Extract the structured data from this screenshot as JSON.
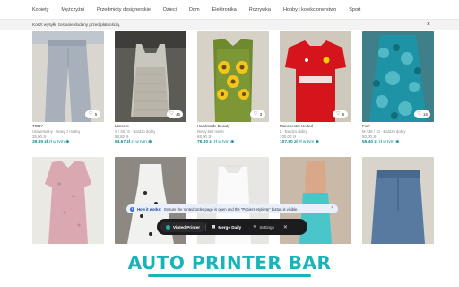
{
  "nav": {
    "categories": [
      "Kobiety",
      "Mężczyźni",
      "Przedmioty designerskie",
      "Dzieci",
      "Dom",
      "Elektronika",
      "Rozrywka",
      "Hobby i kolekcjonerstwo",
      "Sport"
    ]
  },
  "banner": {
    "text": "Koszt wysyłki zostanie dodany przed płatnością.",
    "close": "×"
  },
  "listings": [
    {
      "brand": "TONY",
      "sub": "Uniwersalny · Nowy z metką",
      "price": "35,00 zł",
      "incl": "39,85 zł",
      "incl_label": "zł w tym",
      "favs": "5"
    },
    {
      "brand": "Lancers",
      "sub": "S / 36 / 8 · Bardzo dobry",
      "price": "58,82 zł",
      "incl": "64,67 zł",
      "incl_label": "zł w tym",
      "favs": "45"
    },
    {
      "brand": "Handmade Beauty",
      "sub": "Nowy bez metki",
      "price": "65,90 zł",
      "incl": "76,30 zł",
      "incl_label": "zł w tym",
      "favs": "3"
    },
    {
      "brand": "Manchester United",
      "sub": "L · Bardzo dobry",
      "price": "100,00 zł",
      "incl": "107,90 zł",
      "incl_label": "zł w tym",
      "favs": "5"
    },
    {
      "brand": "Fiori",
      "sub": "M / 38 / 10 · Bardzo dobry",
      "price": "50,00 zł",
      "incl": "55,40 zł",
      "incl_label": "zł w tym",
      "favs": "16"
    }
  ],
  "tooltip": {
    "title": "How it works:",
    "body": "Ensure the Vinted order page is open and the \"Pobierz etykietę\" button is visible.",
    "close": "×"
  },
  "toolbar": {
    "app_label": "Vinted Printer",
    "merge_label": "Merge Daily",
    "settings_label": "Settings",
    "close": "✕"
  },
  "branding": {
    "title": "AUTO PRINTER BAR"
  },
  "colors": {
    "accent": "#18b4b9",
    "price_accent": "#0a8c8c",
    "toolbar_bg": "#1c1c1e"
  }
}
